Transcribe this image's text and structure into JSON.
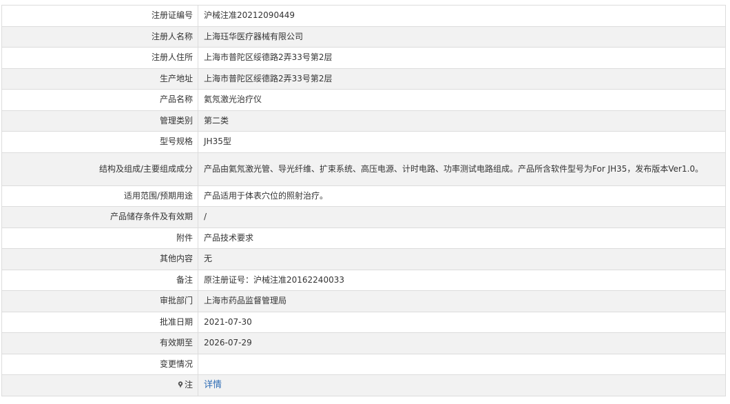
{
  "rows": [
    {
      "label": "注册证编号",
      "value": "沪械注准20212090449"
    },
    {
      "label": "注册人名称",
      "value": "上海珏华医疗器械有限公司"
    },
    {
      "label": "注册人住所",
      "value": "上海市普陀区绥德路2弄33号第2层"
    },
    {
      "label": "生产地址",
      "value": "上海市普陀区绥德路2弄33号第2层"
    },
    {
      "label": "产品名称",
      "value": "氦氖激光治疗仪"
    },
    {
      "label": "管理类别",
      "value": "第二类"
    },
    {
      "label": "型号规格",
      "value": "JH35型"
    },
    {
      "label": "结构及组成/主要组成成分",
      "value": "产品由氦氖激光管、导光纤维、扩束系统、高压电源、计时电路、功率测试电路组成。产品所含软件型号为For JH35，发布版本Ver1.0。"
    },
    {
      "label": "适用范围/预期用途",
      "value": "产品适用于体表穴位的照射治疗。"
    },
    {
      "label": "产品储存条件及有效期",
      "value": "/"
    },
    {
      "label": "附件",
      "value": "产品技术要求"
    },
    {
      "label": "其他内容",
      "value": "无"
    },
    {
      "label": "备注",
      "value": "原注册证号：沪械注准20162240033"
    },
    {
      "label": "审批部门",
      "value": "上海市药品监督管理局"
    },
    {
      "label": "批准日期",
      "value": "2021-07-30"
    },
    {
      "label": "有效期至",
      "value": "2026-07-29"
    },
    {
      "label": "变更情况",
      "value": ""
    }
  ],
  "note": {
    "label": "注",
    "icon": "pin-icon",
    "link": "详情",
    "link_color": "#2f6db5"
  }
}
